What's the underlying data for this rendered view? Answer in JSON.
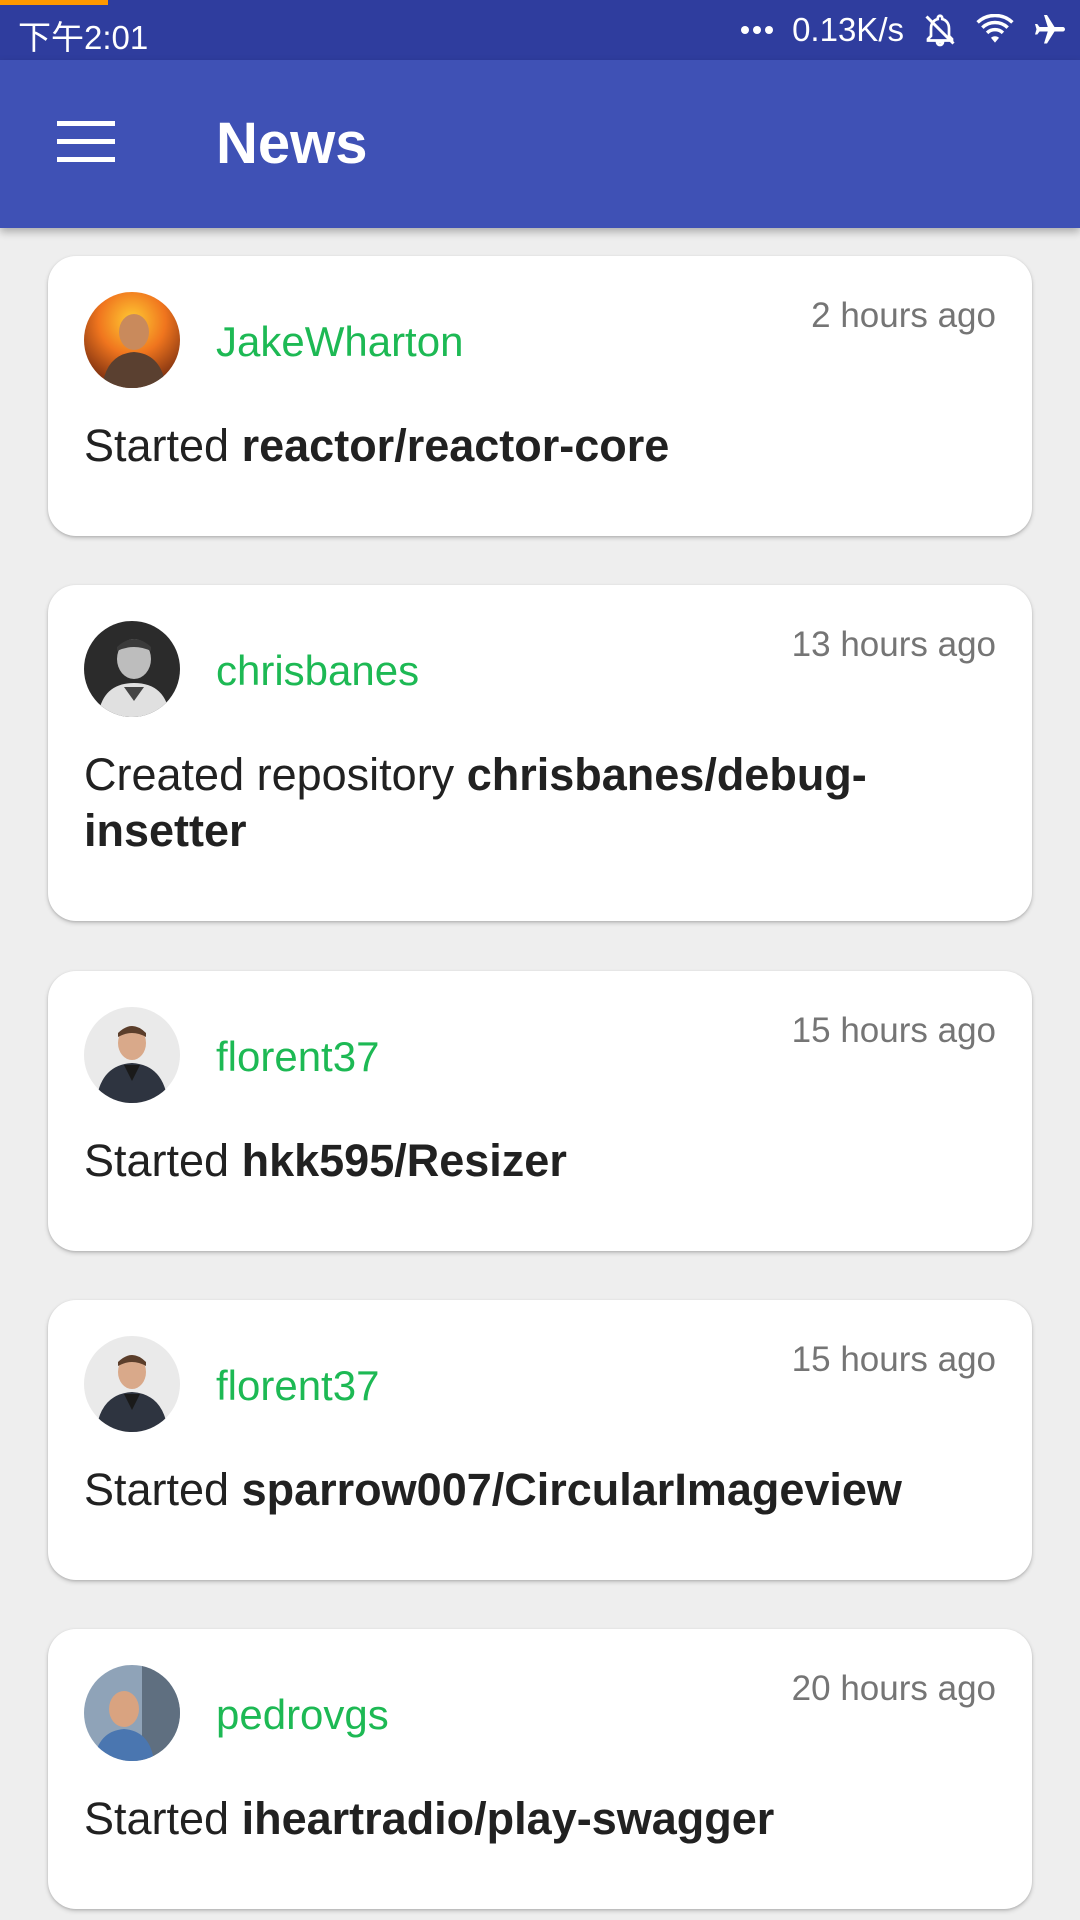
{
  "status_bar": {
    "time": "下午2:01",
    "network_speed": "0.13K/s",
    "icons": [
      "more-dots-icon",
      "muted-bell-icon",
      "wifi-icon",
      "airplane-icon"
    ]
  },
  "app_bar": {
    "title": "News",
    "menu_icon": "hamburger-menu-icon"
  },
  "colors": {
    "status_bar": "#2f3d9e",
    "app_bar": "#3f51b5",
    "username": "#1db954",
    "timestamp": "#757575",
    "text": "#212121",
    "background": "#eeeeee"
  },
  "feed": [
    {
      "user": "JakeWharton",
      "time": "2 hours ago",
      "action": "Started",
      "repo": "reactor/reactor-core",
      "avatar": "avatar-jakewharton"
    },
    {
      "user": "chrisbanes",
      "time": "13 hours ago",
      "action": "Created repository",
      "repo": "chrisbanes/debug-insetter",
      "avatar": "avatar-chrisbanes"
    },
    {
      "user": "florent37",
      "time": "15 hours ago",
      "action": "Started",
      "repo": "hkk595/Resizer",
      "avatar": "avatar-florent37"
    },
    {
      "user": "florent37",
      "time": "15 hours ago",
      "action": "Started",
      "repo": "sparrow007/CircularImageview",
      "avatar": "avatar-florent37"
    },
    {
      "user": "pedrovgs",
      "time": "20 hours ago",
      "action": "Started",
      "repo": "iheartradio/play-swagger",
      "avatar": "avatar-pedrovgs"
    }
  ]
}
